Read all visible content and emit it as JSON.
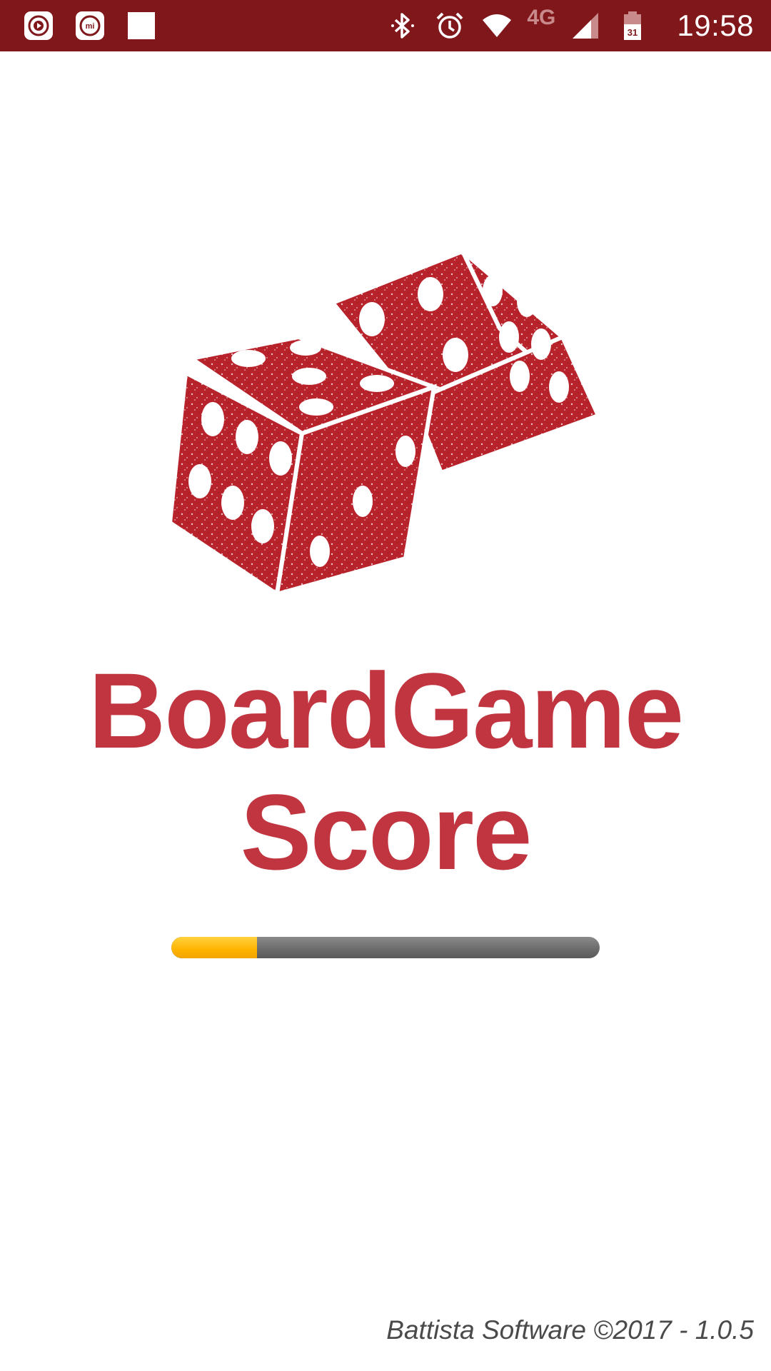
{
  "status_bar": {
    "left_icons": [
      "media-player-icon",
      "mi-app-icon",
      "blank-notification-icon"
    ],
    "right_icons": [
      "bluetooth-icon",
      "alarm-icon",
      "wifi-icon",
      "cellular-signal-icon",
      "battery-icon"
    ],
    "network_label": "4G",
    "battery_text": "31",
    "time": "19:58",
    "background_color": "#7f171b"
  },
  "splash": {
    "logo_icon": "dice-icon",
    "title_line1": "BoardGame",
    "title_line2": "Score",
    "title_color": "#c0353f",
    "loading_progress": 0.2,
    "progress_fill_color": "#ffb300",
    "progress_track_color": "#6f6f6f"
  },
  "footer": {
    "copyright": "Battista Software ©2017 - 1.0.5"
  }
}
